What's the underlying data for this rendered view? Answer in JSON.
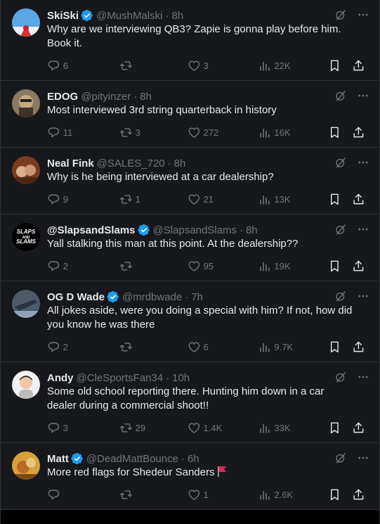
{
  "tweets": [
    {
      "name": "SkiSki",
      "verified": true,
      "handle": "@MushMalski",
      "time": "8h",
      "text": "Why are we interviewing QB3? Zapie is gonna play before him. Book it.",
      "replies": "6",
      "reposts": "",
      "likes": "3",
      "views": "22K",
      "avatar": "skiski-avatar"
    },
    {
      "name": "EDOG",
      "verified": false,
      "handle": "@pityinzer",
      "time": "8h",
      "text": "Most interviewed 3rd string quarterback in history",
      "replies": "11",
      "reposts": "3",
      "likes": "272",
      "views": "16K",
      "avatar": "edog-avatar"
    },
    {
      "name": "Neal Fink",
      "verified": false,
      "handle": "@SALES_720",
      "time": "8h",
      "text": "Why is he being interviewed at a car dealership?",
      "replies": "9",
      "reposts": "1",
      "likes": "21",
      "views": "13K",
      "avatar": "neal-avatar"
    },
    {
      "name": "@SlapsandSlams",
      "verified": true,
      "handle": "@SlapsandSlams",
      "time": "8h",
      "text": "Yall stalking this man at this point. At the dealership??",
      "replies": "2",
      "reposts": "",
      "likes": "95",
      "views": "19K",
      "avatar": "slaps-avatar",
      "avatar_text": [
        "SLAPS",
        "AND",
        "SLAMS"
      ]
    },
    {
      "name": "OG D Wade",
      "verified": true,
      "handle": "@mrdbwade",
      "time": "7h",
      "text": "All jokes aside, were you doing a special with him?  If not, how did you know he was there",
      "replies": "2",
      "reposts": "",
      "likes": "6",
      "views": "9.7K",
      "avatar": "ogdwade-avatar"
    },
    {
      "name": "Andy",
      "verified": false,
      "handle": "@CleSportsFan34",
      "time": "10h",
      "text": "Some old school reporting there. Hunting him down in a car dealer during a commercial shoot!!",
      "replies": "3",
      "reposts": "29",
      "likes": "1.4K",
      "views": "33K",
      "avatar": "andy-avatar"
    },
    {
      "name": "Matt",
      "verified": true,
      "handle": "@DeadMattBounce",
      "time": "6h",
      "text": "More red flags for Shedeur Sanders",
      "replies": "",
      "reposts": "",
      "likes": "1",
      "views": "2.6K",
      "avatar": "matt-avatar",
      "trailing_emoji": "red-flag-icon"
    }
  ],
  "separator_dot": "·",
  "colors": {
    "background": "#16181c",
    "text": "#e7e9ea",
    "muted": "#71767b",
    "verified": "#1d9bf0",
    "border": "#2f3336"
  }
}
